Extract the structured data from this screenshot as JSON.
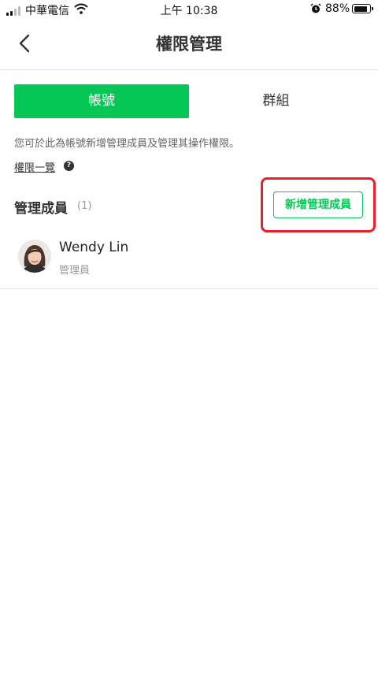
{
  "status_bar": {
    "carrier": "中華電信",
    "time": "上午 10:38",
    "battery_percent": "88%",
    "battery_level": 0.88,
    "icons": [
      "signal-icon",
      "wifi-icon",
      "alarm-icon",
      "battery-icon"
    ]
  },
  "header": {
    "title": "權限管理",
    "back_icon": "chevron-left-icon"
  },
  "tabs": [
    {
      "label": "帳號",
      "active": true
    },
    {
      "label": "群組",
      "active": false
    }
  ],
  "description": "您可於此為帳號新增管理成員及管理其操作權限。",
  "permission_list_link": "權限一覽",
  "help_glyph": "?",
  "members_section": {
    "title": "管理成員",
    "count": "(1)",
    "add_button_label": "新增管理成員"
  },
  "members": [
    {
      "name": "Wendy Lin",
      "role": "管理員"
    }
  ],
  "colors": {
    "accent": "#06c755",
    "highlight": "#e8202a"
  }
}
